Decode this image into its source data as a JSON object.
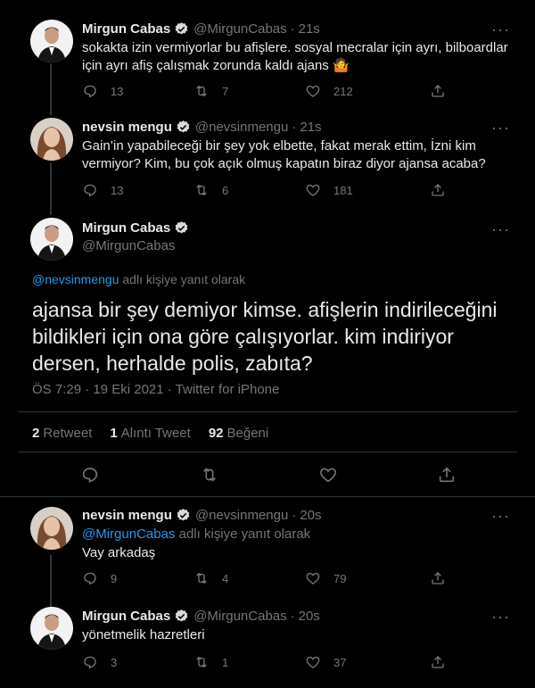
{
  "tweets": [
    {
      "name": "Mirgun Cabas",
      "handle": "@MirgunCabas",
      "time": "21s",
      "text": "sokakta izin vermiyorlar bu afişlere. sosyal mecralar için ayrı, bilboardlar için ayrı afiş  çalışmak zorunda kaldı ajans 🤷",
      "replies": "13",
      "retweets": "7",
      "likes": "212"
    },
    {
      "name": "nevsin mengu",
      "handle": "@nevsinmengu",
      "time": "21s",
      "text": "Gain’in yapabileceği bir şey yok elbette, fakat merak ettim, İzni kim vermiyor? Kim, bu çok açık olmuş kapatın biraz diyor ajansa acaba?",
      "replies": "13",
      "retweets": "6",
      "likes": "181"
    }
  ],
  "main_tweet": {
    "name": "Mirgun Cabas",
    "handle": "@MirgunCabas",
    "reply_mention": "@nevsinmengu",
    "reply_suffix": " adlı kişiye yanıt olarak",
    "text": "ajansa bir şey demiyor kimse. afişlerin indirileceğini bildikleri için ona göre çalışıyorlar. kim indiriyor dersen, herhalde polis, zabıta?",
    "meta": "ÖS 7:29 · 19 Eki 2021 · Twitter for iPhone",
    "retweet_count": "2",
    "retweet_label": "Retweet",
    "quote_count": "1",
    "quote_label": "Alıntı Tweet",
    "like_count": "92",
    "like_label": "Beğeni"
  },
  "replies": [
    {
      "name": "nevsin mengu",
      "handle": "@nevsinmengu",
      "time": "20s",
      "reply_mention": "@MirgunCabas",
      "reply_suffix": " adlı kişiye yanıt olarak",
      "text": "Vay arkadaş",
      "replies": "9",
      "retweets": "4",
      "likes": "79"
    },
    {
      "name": "Mirgun Cabas",
      "handle": "@MirgunCabas",
      "time": "20s",
      "text": "yönetmelik hazretleri",
      "replies": "3",
      "retweets": "1",
      "likes": "37"
    }
  ],
  "dot": "·",
  "more_label": "···",
  "colors": {
    "background": "#000000",
    "accent": "#1d9bf0",
    "muted": "#71767b",
    "verified": "#d9d9d9"
  }
}
